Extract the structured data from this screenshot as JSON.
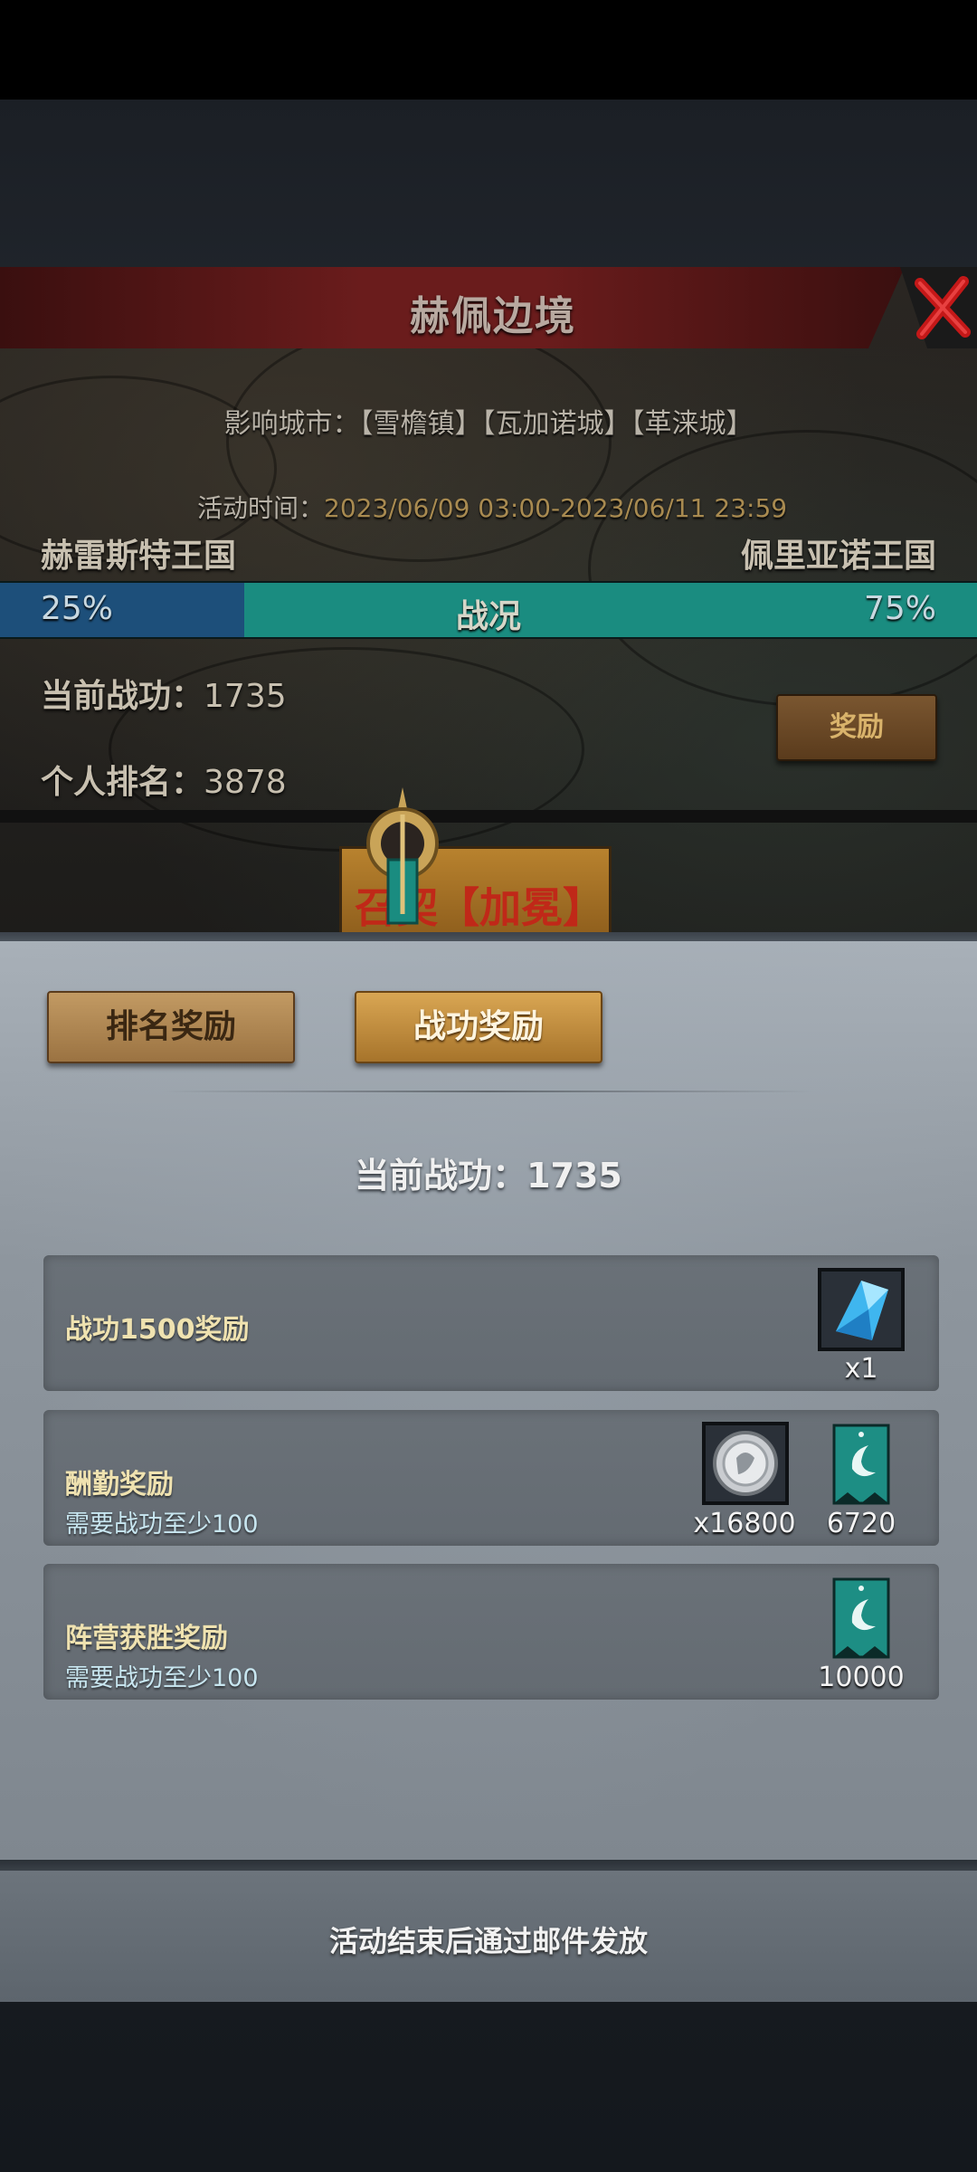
{
  "event": {
    "title": "赫佩边境",
    "cities": "影响城市：【雪檐镇】【瓦加诺城】【革涞城】",
    "time_label": "活动时间：",
    "time_value": "2023/06/09 03:00-2023/06/11 23:59",
    "faction_left": "赫雷斯特王国",
    "faction_right": "佩里亚诺王国",
    "war_label": "战况",
    "left_pct_text": "25%",
    "right_pct_text": "75%",
    "left_share": 0.25,
    "merit_label": "当前战功：",
    "merit_value": "1735",
    "rank_label": "个人排名：",
    "rank_value": "3878",
    "reward_button": "奖励",
    "banner_text": "召契【加冕】",
    "close_icon": "close-x-icon",
    "emblem_icon": "faction-emblem-icon"
  },
  "rewards": {
    "tabs": [
      {
        "label": "排名奖励",
        "active": false
      },
      {
        "label": "战功奖励",
        "active": true
      }
    ],
    "current_merit": "当前战功：1735",
    "rows": [
      {
        "title": "战功1500奖励",
        "subtitle": "",
        "items": [
          {
            "icon": "blue-crystal-icon",
            "count": "x1"
          }
        ]
      },
      {
        "title": "酬勤奖励",
        "subtitle": "需要战功至少100",
        "items": [
          {
            "icon": "silver-coin-icon",
            "count": "x16800"
          },
          {
            "icon": "teal-banner-icon",
            "count": "6720"
          }
        ]
      },
      {
        "title": "阵营获胜奖励",
        "subtitle": "需要战功至少100",
        "items": [
          {
            "icon": "teal-banner-icon",
            "count": "10000"
          }
        ]
      }
    ],
    "footer": "活动结束后通过邮件发放"
  },
  "colors": {
    "left_faction_bar": "#1d4f7a",
    "right_faction_bar": "#1a8c80",
    "title_bar": "#6a1c1c",
    "accent_gold": "#d9a653"
  }
}
